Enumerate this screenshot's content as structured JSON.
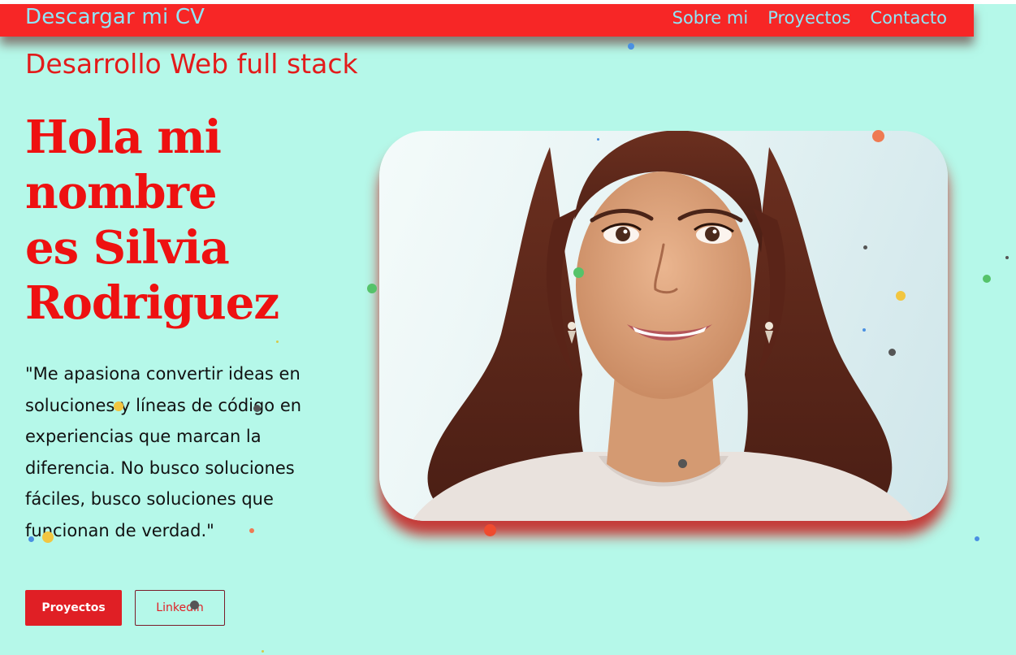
{
  "nav": {
    "brand": "Descargar mi CV",
    "links": [
      "Sobre mi",
      "Proyectos",
      "Contacto"
    ]
  },
  "hero": {
    "subtitle": "Desarrollo Web full stack",
    "title_lines": [
      "Hola mi",
      "nombre",
      "es Silvia",
      "Rodriguez"
    ],
    "quote": "\"Me apasiona convertir ideas en soluciones y líneas de código en experiencias que marcan la diferencia. No busco soluciones fáciles, busco soluciones que funcionan de verdad.\"",
    "buttons": {
      "projects": "Proyectos",
      "linkedin": "Linkedin"
    }
  },
  "colors": {
    "background": "#b5f8e9",
    "navbar": "#f72626",
    "nav_text": "#8fe6f7",
    "accent_red": "#ee1111",
    "button_red": "#e01f25"
  },
  "images": {
    "portrait": "illustrated-portrait-woman"
  }
}
